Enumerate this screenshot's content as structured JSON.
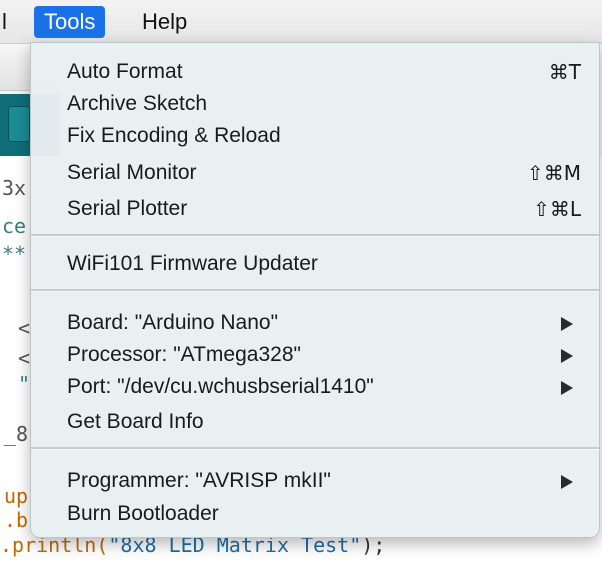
{
  "menubar": {
    "partial_label": "l",
    "tools_label": "Tools",
    "help_label": "Help"
  },
  "editor": {
    "fragments": [
      "3x",
      "ce",
      "**",
      "<",
      "<",
      "\"",
      "_8",
      "up",
      ".b"
    ],
    "bottom_line_prefix": ".println(",
    "bottom_line_string": "\"8x8 LED Matrix Test\"",
    "bottom_line_suffix": ");"
  },
  "tools_menu": {
    "auto_format": {
      "label": "Auto Format",
      "shortcut": "⌘T"
    },
    "archive_sketch": {
      "label": "Archive Sketch"
    },
    "fix_encoding": {
      "label": "Fix Encoding & Reload"
    },
    "serial_monitor": {
      "label": "Serial Monitor",
      "shortcut": "⇧⌘M"
    },
    "serial_plotter": {
      "label": "Serial Plotter",
      "shortcut": "⇧⌘L"
    },
    "wifi_updater": {
      "label": "WiFi101 Firmware Updater"
    },
    "board": {
      "label": "Board: \"Arduino Nano\""
    },
    "processor": {
      "label": "Processor: \"ATmega328\""
    },
    "port": {
      "label": "Port: \"/dev/cu.wchusbserial1410\""
    },
    "board_info": {
      "label": "Get Board Info"
    },
    "programmer": {
      "label": "Programmer: \"AVRISP mkII\""
    },
    "burn_bootloader": {
      "label": "Burn Bootloader"
    }
  },
  "colors": {
    "menu_highlight": "#1b72e8",
    "toolbar_teal": "#0f6e78"
  }
}
